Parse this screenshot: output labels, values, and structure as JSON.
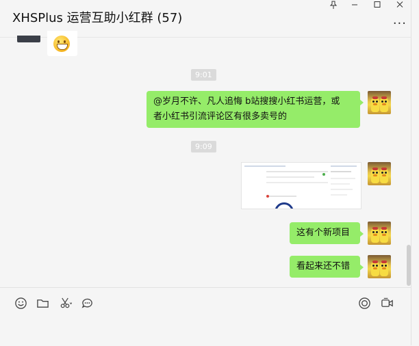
{
  "window": {
    "title": "XHSPlus 运营互助小红群 (57)",
    "controls": {
      "pin": "pin-icon",
      "minimize": "minimize-icon",
      "maximize": "maximize-icon",
      "close": "close-icon"
    },
    "more_label": "···"
  },
  "chat": {
    "timestamps": [
      "9:01",
      "9:09"
    ],
    "messages": [
      {
        "text": "@岁月不许、凡人追悔 b站搜搜小红书运营，或者小红书引流评论区有很多卖号的",
        "lines": [
          "@岁月不许、凡人追悔 b站搜搜小红书运营，或",
          "者小红书引流评论区有很多卖号的"
        ]
      },
      {
        "text": "这有个新项目"
      },
      {
        "text": "看起来还不错"
      }
    ]
  },
  "toolbar": {
    "left_icons": [
      "emoji-icon",
      "folder-icon",
      "scissors-icon",
      "chat-history-icon"
    ],
    "right_icons": [
      "live-icon",
      "video-call-icon"
    ]
  },
  "colors": {
    "bubble": "#95ec69",
    "background": "#f5f5f5",
    "timestamp_bg": "#dadada"
  }
}
